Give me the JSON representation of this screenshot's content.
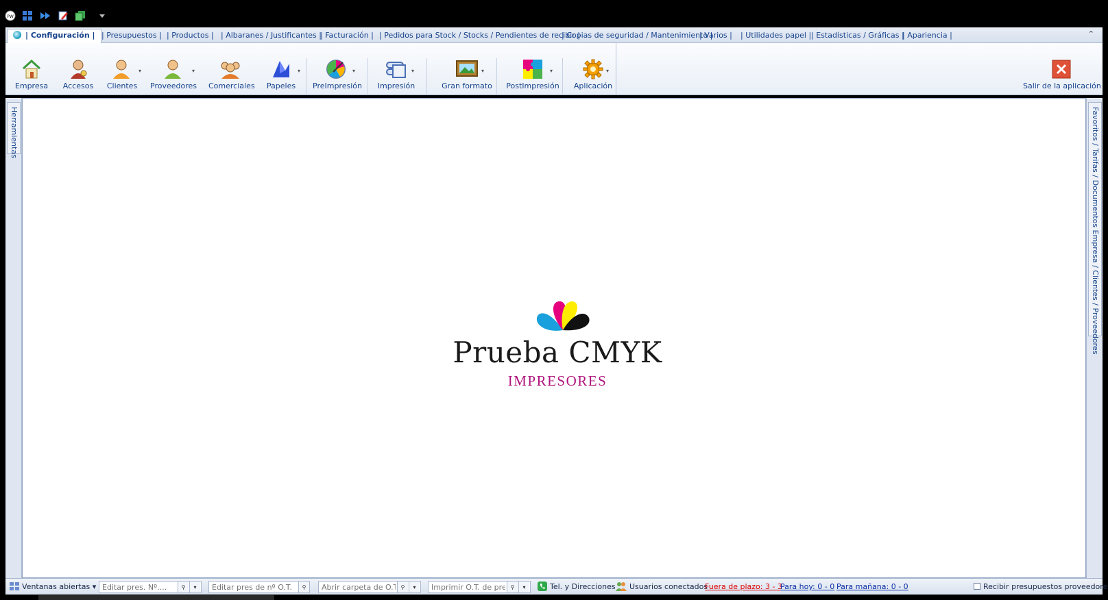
{
  "tabs": [
    {
      "label": "| Configuración |",
      "active": true
    },
    {
      "label": "| Presupuestos |"
    },
    {
      "label": "| Productos |"
    },
    {
      "label": "| Albaranes / Justificantes |"
    },
    {
      "label": "| Facturación |"
    },
    {
      "label": "| Pedidos para Stock / Stocks / Pendientes de recibir |"
    },
    {
      "label": "| Copias de seguridad / Mantenimiento |"
    },
    {
      "label": "| Varios |"
    },
    {
      "label": "| Utilidades papel |"
    },
    {
      "label": "| Estadísticas / Gráficas |"
    },
    {
      "label": "| Apariencia |"
    }
  ],
  "ribbon": {
    "buttons": [
      {
        "label": "Empresa",
        "icon": "house-icon"
      },
      {
        "label": "Accesos",
        "icon": "user-key-icon"
      },
      {
        "label": "Clientes",
        "icon": "client-icon"
      },
      {
        "label": "Proveedores",
        "icon": "supplier-icon"
      },
      {
        "label": "Comerciales",
        "icon": "sales-team-icon"
      },
      {
        "label": "Papeles",
        "icon": "paper-icon"
      },
      {
        "label": "PreImpresión",
        "icon": "color-wheel-icon"
      },
      {
        "label": "Impresión",
        "icon": "printer-icon"
      },
      {
        "label": "Gran formato",
        "icon": "large-format-icon"
      },
      {
        "label": "PostImpresión",
        "icon": "puzzle-icon"
      },
      {
        "label": "Aplicación",
        "icon": "gear-icon"
      }
    ],
    "exit_label": "Salir de la aplicación"
  },
  "side": {
    "left_tab": "Herramientas",
    "right_tab": "Favoritos / Tarifas / Documentos Empresa  / Clientes / Proveedores"
  },
  "logo": {
    "brand": "Prueba CMYK",
    "subtitle": "IMPRESORES",
    "colors": {
      "cyan": "#1aa0dc",
      "magenta": "#e6007e",
      "yellow": "#ffed00",
      "black": "#111111"
    }
  },
  "statusbar": {
    "windows_label": "Ventanas abiertas",
    "edit_pres_placeholder": "Editar pres. Nº....",
    "edit_pres_ot_placeholder": "Editar pres de nº O.T.",
    "open_folder_placeholder": "Abrir carpeta de O.T.",
    "print_ot_placeholder": "Imprimir O.T. de pre...",
    "tel_label": "Tel. y Direcciones",
    "users_label": "Usuarios conectados",
    "overdue_label": "Fuera de plazo: 3 - 3",
    "today_label": "Para hoy: 0 - 0",
    "tomorrow_label": "Para mañana: 0 - 0",
    "receive_label": "Recibir presupuestos proveedores"
  }
}
